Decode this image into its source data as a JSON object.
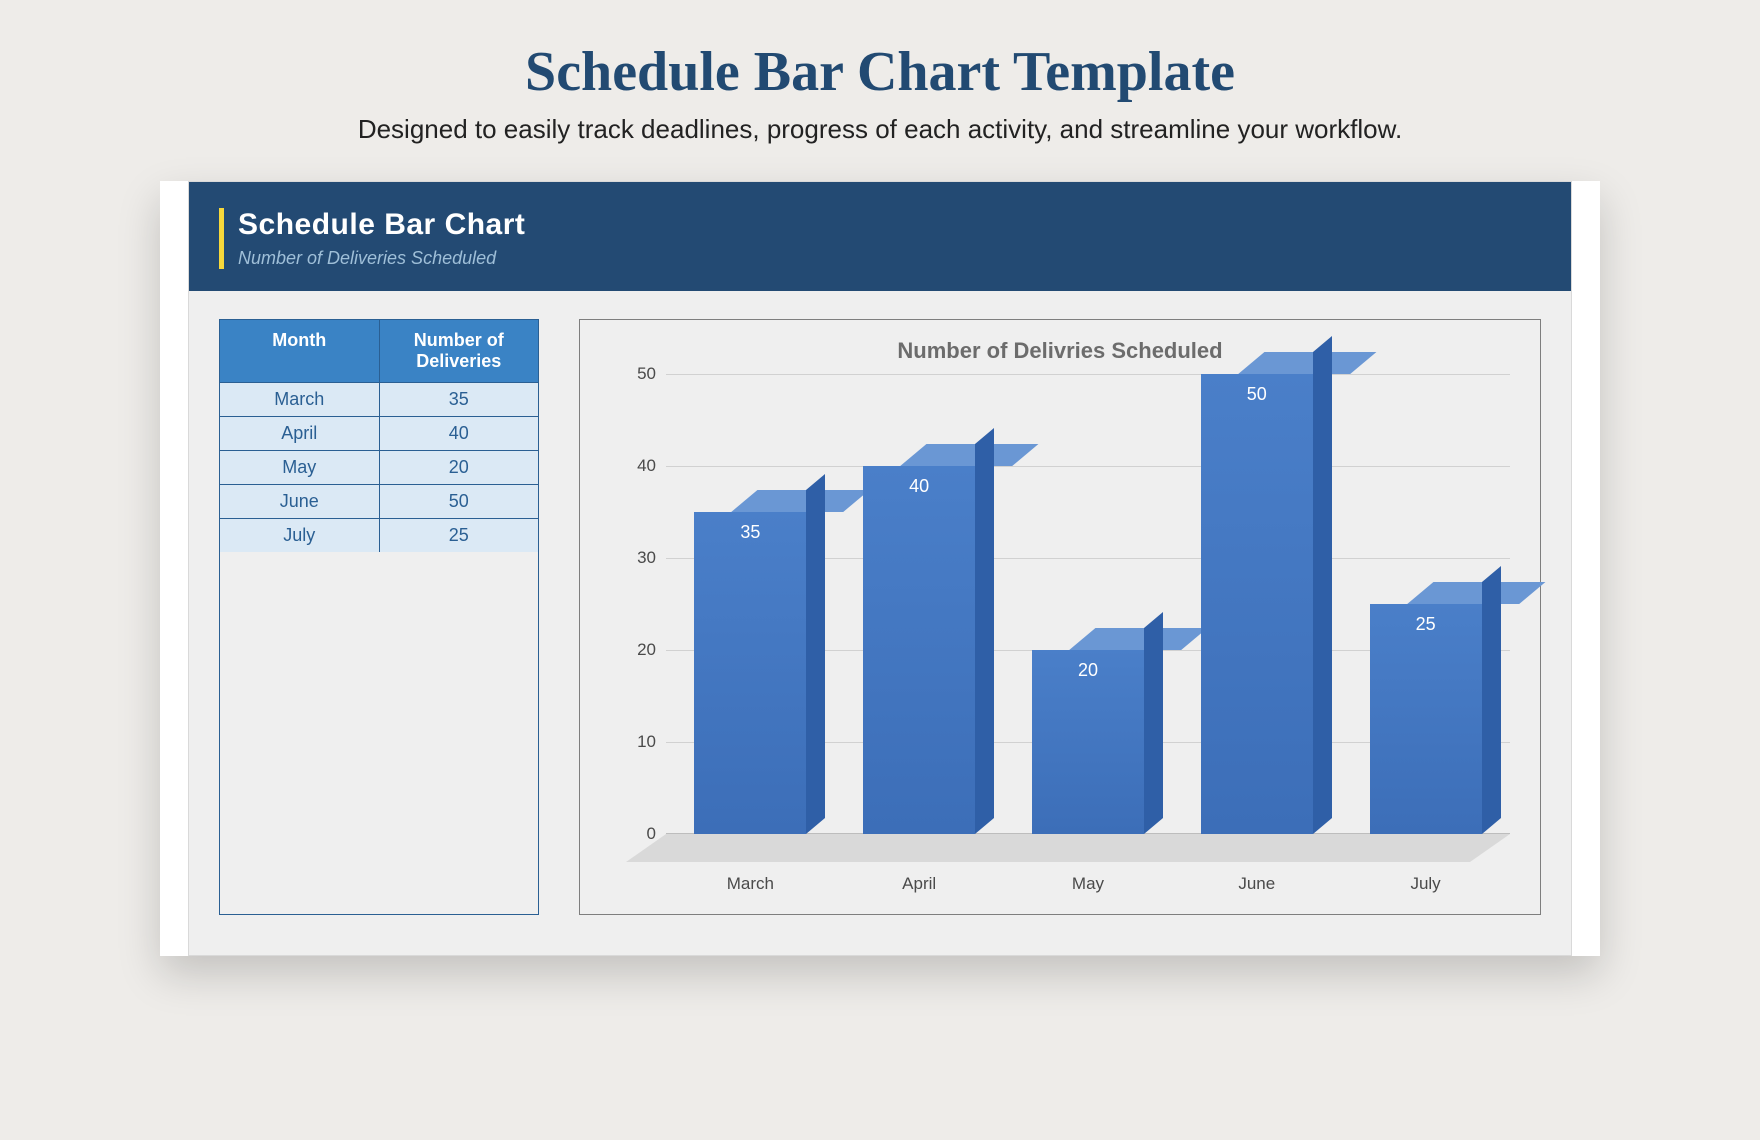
{
  "page": {
    "title": "Schedule Bar Chart Template",
    "subtitle": "Designed to easily track deadlines, progress of each activity, and streamline your workflow."
  },
  "banner": {
    "title": "Schedule Bar Chart",
    "subtitle": "Number of Deliveries Scheduled"
  },
  "table": {
    "headers": {
      "col1": "Month",
      "col2": "Number of Deliveries"
    },
    "rows": [
      {
        "month": "March",
        "value": "35"
      },
      {
        "month": "April",
        "value": "40"
      },
      {
        "month": "May",
        "value": "20"
      },
      {
        "month": "June",
        "value": "50"
      },
      {
        "month": "July",
        "value": "25"
      }
    ]
  },
  "chart_data": {
    "type": "bar",
    "title": "Number of Delivries Scheduled",
    "xlabel": "",
    "ylabel": "",
    "categories": [
      "March",
      "April",
      "May",
      "June",
      "July"
    ],
    "values": [
      35,
      40,
      20,
      50,
      25
    ],
    "ylim": [
      0,
      50
    ],
    "y_ticks": [
      0,
      10,
      20,
      30,
      40,
      50
    ]
  },
  "colors": {
    "banner_bg": "#234a73",
    "accent_yellow": "#f7d83b",
    "table_header": "#3a83c5",
    "table_row": "#dbe9f5",
    "bar_front": "#3c6eb8",
    "bar_top": "#6a97d4",
    "bar_side": "#2f5fa7"
  }
}
